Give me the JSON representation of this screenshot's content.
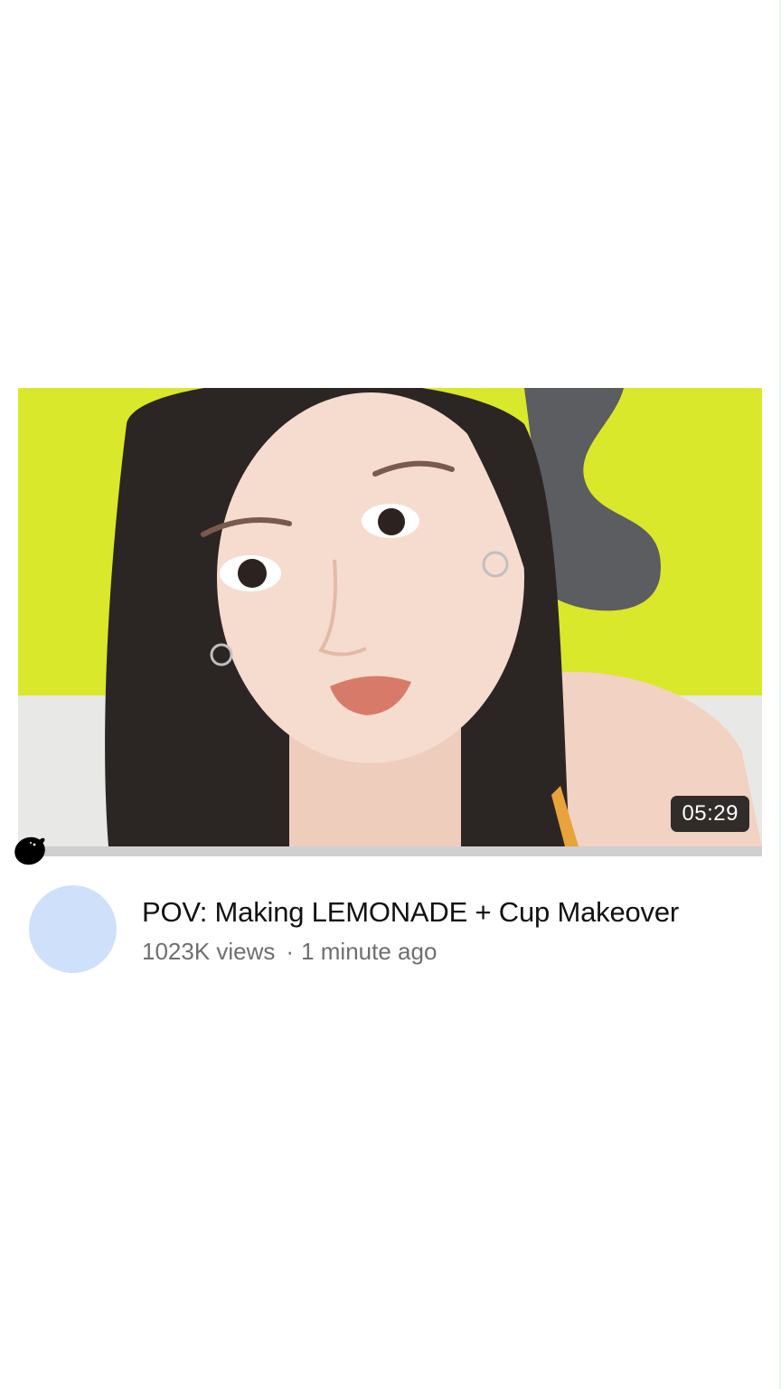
{
  "video": {
    "duration": "05:29",
    "progress_fraction": 0.0,
    "title": "POV: Making LEMONADE + Cup Makeover",
    "views": "1023K views",
    "separator": "·",
    "age": "1 minute ago",
    "thumbnail_icon": "thumbnail-image",
    "progress_icon": "lemon-icon"
  },
  "colors": {
    "avatar": "#cfe0fb",
    "progress_track": "#cfcfcf",
    "backdrop_yellow": "#d9e82a"
  }
}
